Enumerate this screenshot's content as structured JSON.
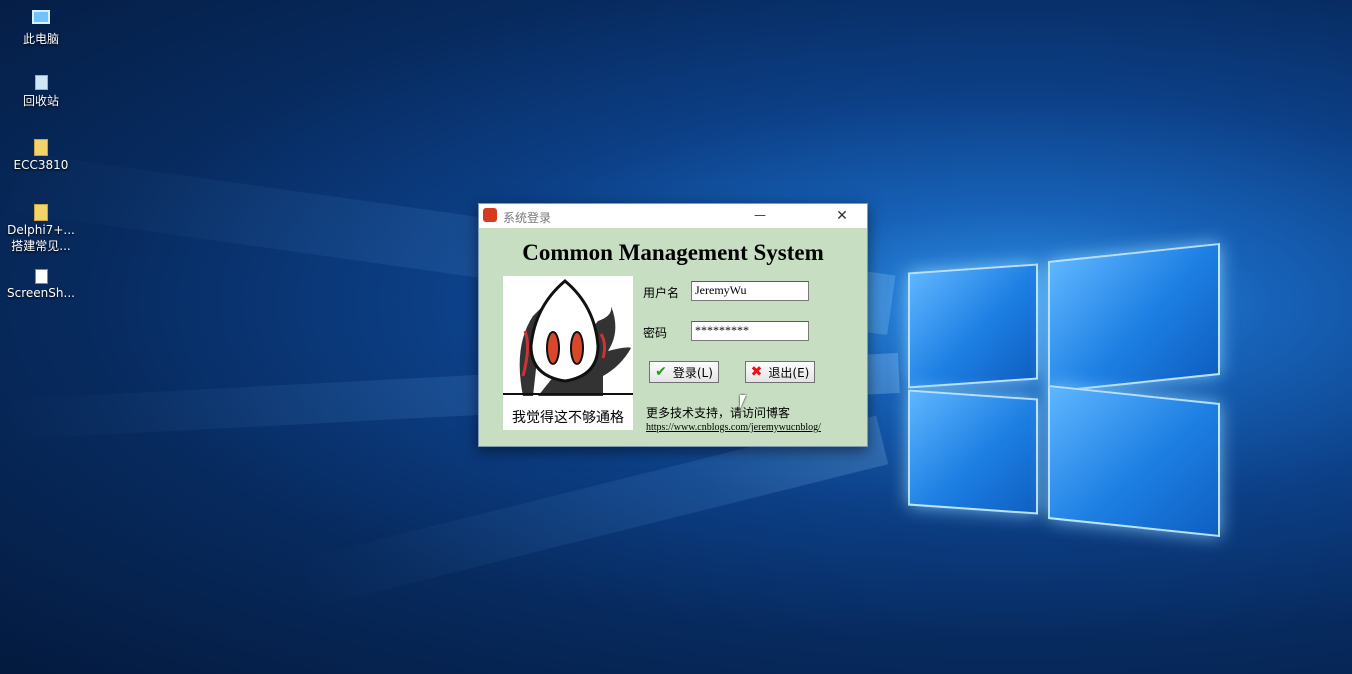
{
  "desktop": {
    "icons": [
      {
        "label": "此电脑",
        "icon": "computer-icon"
      },
      {
        "label": "回收站",
        "icon": "recycle-bin-icon"
      },
      {
        "label": "ECC3810",
        "icon": "folder-icon"
      },
      {
        "label": "Delphi7+...",
        "label2": "搭建常见...",
        "icon": "folder-icon"
      },
      {
        "label": "ScreenSh...",
        "icon": "file-icon"
      }
    ]
  },
  "dialog": {
    "title": "系统登录",
    "minimize_glyph": "—",
    "close_glyph": "✕",
    "app_title": "Common Management System",
    "meme_caption": "我觉得这不够通格",
    "username_label": "用户名",
    "username_value": "JeremyWu",
    "password_label": "密码",
    "password_value": "*********",
    "login_label": "登录(L)",
    "exit_label": "退出(E)",
    "support_text": "更多技术支持，请访问博客",
    "link_text": "https://www.cnblogs.com/jeremywucnblog/"
  },
  "colors": {
    "dialog_bg": "#c8dec3",
    "wallpaper": "#0c3f86"
  }
}
